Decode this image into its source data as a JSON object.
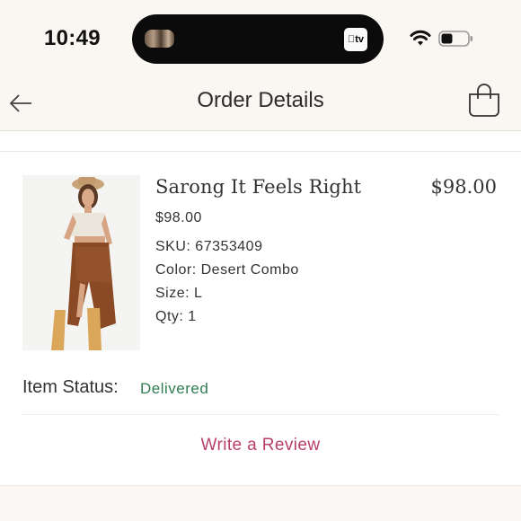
{
  "status_bar": {
    "time": "10:49",
    "tv_label": "tv"
  },
  "nav": {
    "title": "Order Details"
  },
  "item": {
    "name": "Sarong It Feels Right",
    "total_price": "$98.00",
    "unit_price": "$98.00",
    "sku": "SKU: 67353409",
    "color": "Color: Desert Combo",
    "size": "Size: L",
    "qty": "Qty: 1"
  },
  "status": {
    "label": "Item Status:",
    "value": "Delivered"
  },
  "actions": {
    "review": "Write a Review"
  },
  "colors": {
    "background_top": "#faf6f1",
    "delivered_green": "#2f7d52",
    "review_pink": "#b8406a"
  },
  "icons": [
    "back-arrow-icon",
    "shopping-bag-icon",
    "wifi-icon",
    "battery-icon",
    "apple-tv-icon"
  ]
}
